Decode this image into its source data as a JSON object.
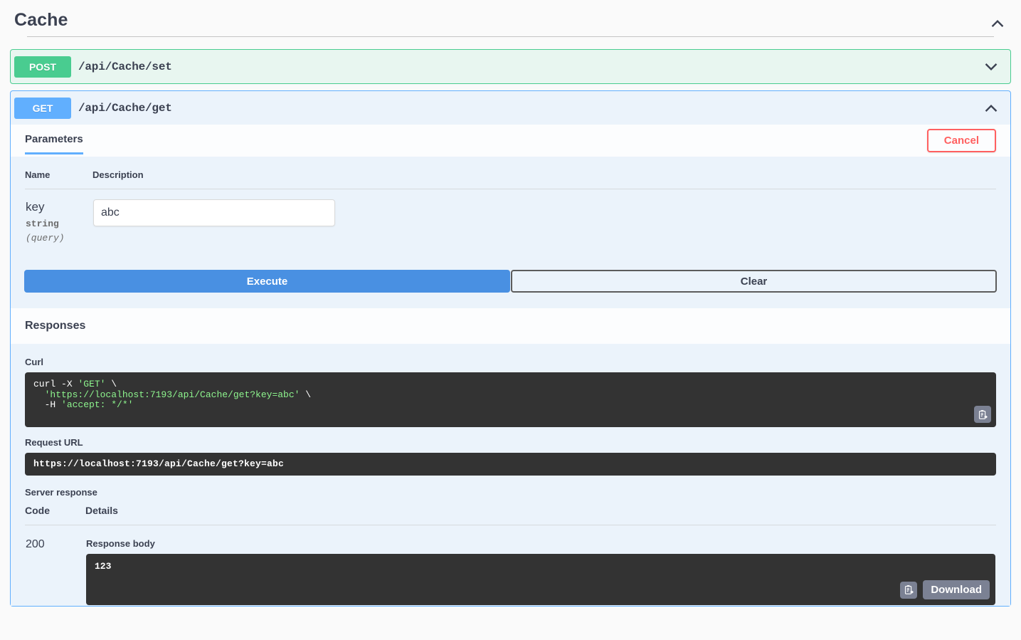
{
  "tag": {
    "title": "Cache",
    "collapse_icon": "chevron-up-icon"
  },
  "operations": [
    {
      "method": "POST",
      "path": "/api/Cache/set",
      "expanded": false,
      "toggle_icon": "chevron-down-icon"
    },
    {
      "method": "GET",
      "path": "/api/Cache/get",
      "expanded": true,
      "toggle_icon": "chevron-up-icon"
    }
  ],
  "get_operation": {
    "tabs": [
      {
        "label": "Parameters",
        "active": true
      }
    ],
    "cancel_label": "Cancel",
    "parameters": {
      "headers": {
        "name": "Name",
        "description": "Description"
      },
      "rows": [
        {
          "name": "key",
          "type": "string",
          "in": "(query)",
          "value": "abc",
          "placeholder": ""
        }
      ]
    },
    "execute_label": "Execute",
    "clear_label": "Clear",
    "responses": {
      "heading": "Responses",
      "curl_label": "Curl",
      "curl_line_1_cmd": "curl",
      "curl_line_1_flag": " -X ",
      "curl_line_1_method": "'GET'",
      "curl_line_1_cont": " \\",
      "curl_line_2": "  'https://localhost:7193/api/Cache/get?key=abc'",
      "curl_line_2_cont": " \\",
      "curl_line_3_flag": "  -H ",
      "curl_line_3_val": "'accept: */*'",
      "copy_icon": "copy-to-clipboard-icon",
      "request_url_label": "Request URL",
      "request_url": "https://localhost:7193/api/Cache/get?key=abc",
      "server_response_label": "Server response",
      "table_headers": {
        "code": "Code",
        "details": "Details"
      },
      "rows": [
        {
          "code": "200",
          "response_body_label": "Response body",
          "response_body": "123",
          "copy_icon": "copy-to-clipboard-icon",
          "download_label": "Download"
        }
      ]
    }
  },
  "colors": {
    "post_green": "#49cc90",
    "get_blue": "#61affe",
    "execute_blue": "#4990e2",
    "cancel_red": "#ff6060",
    "code_bg": "#333333",
    "curl_green": "#8ef58e",
    "panel_bg": "#ebf3fb"
  }
}
